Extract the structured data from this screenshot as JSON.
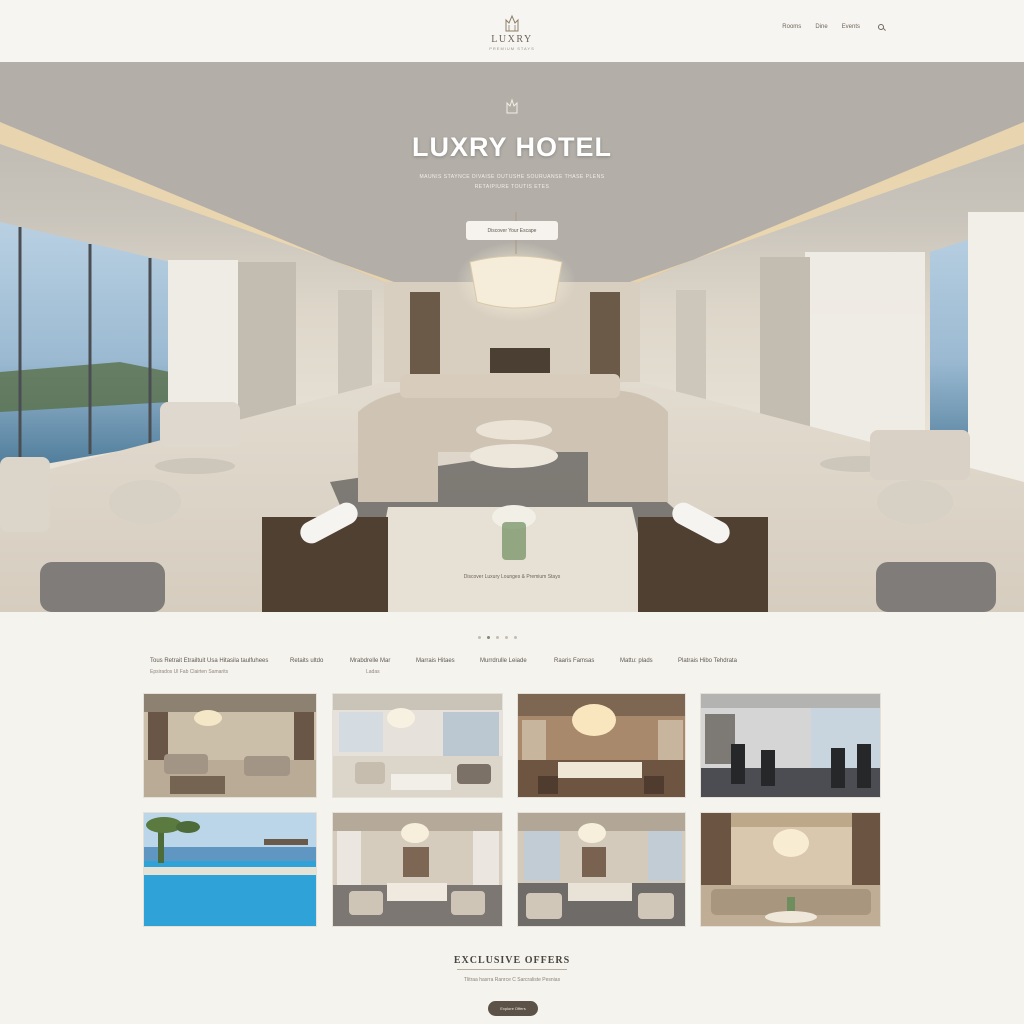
{
  "brand": {
    "name": "LUXRY",
    "tagline": "PREMIUM STAYS"
  },
  "nav": {
    "links": [
      "Rooms",
      "Dine",
      "Events"
    ],
    "search_icon": "search-icon"
  },
  "hero": {
    "title": "LUXRY HOTEL",
    "subtitle_line1": "MAUNIS STAYNCE DIVAISE OUTUSHE SOURUANSE THASE PLENS",
    "subtitle_line2": "RETAIPIURE TOUTIS ETES",
    "cta_label": "Discover Your Escape",
    "caption": "Discover Luxury Lounges & Premium Stays"
  },
  "gallery": {
    "active_dot": 1,
    "dot_count": 5,
    "filters": [
      {
        "label": "Tous Retrait Etrailtuit Usa Hitasila taulfuhees",
        "sub": "Epsirados Ul Fab Clairten Samarits"
      },
      {
        "label": "Retaits ultdo",
        "sub": ""
      },
      {
        "label": "Mrabdrelle Mar",
        "sub": "Ladas"
      },
      {
        "label": "Marrais Hitaes",
        "sub": ""
      },
      {
        "label": "Murrdrulle Leiade",
        "sub": ""
      },
      {
        "label": "Raaris Famsas",
        "sub": ""
      },
      {
        "label": "Mattu: plads",
        "sub": ""
      },
      {
        "label": "Platrais Hibo Tehdrata",
        "sub": ""
      }
    ],
    "tiles": [
      "lounge",
      "dining-hall",
      "restaurant",
      "fitness-center",
      "pool",
      "lobby",
      "lobby-lounge",
      "private-lounge"
    ]
  },
  "offers": {
    "title": "EXCLUSIVE OFFERS",
    "subtitle": "Tlitraa hasrra Ranrce C Sarcraliste Pesnias",
    "button_label": "Explore Offers"
  },
  "colors": {
    "background": "#f5f3ee",
    "accent": "#5c5248",
    "hero_text": "#ffffff"
  }
}
